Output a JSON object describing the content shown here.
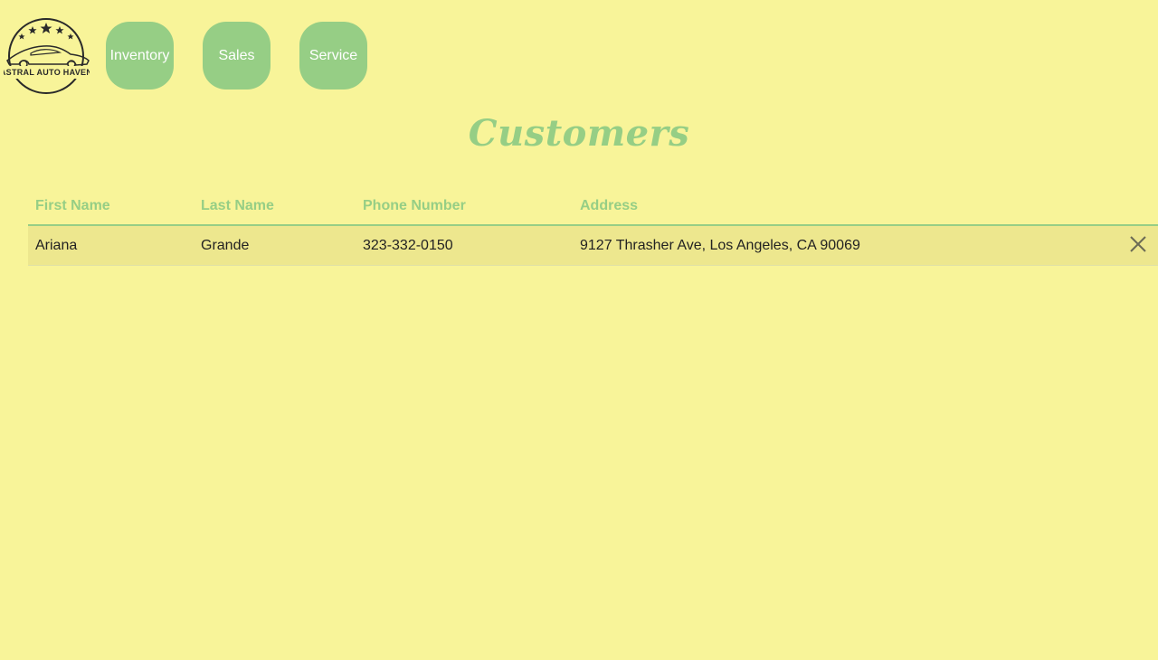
{
  "logo": {
    "text": "ASTRAL AUTO HAVEN",
    "icon": "car-logo-icon"
  },
  "nav": {
    "items": [
      {
        "label": "Inventory"
      },
      {
        "label": "Sales"
      },
      {
        "label": "Service"
      }
    ]
  },
  "colors": {
    "background": "#f8f499",
    "accent": "#96ce85",
    "row_background": "#ede78e"
  },
  "page": {
    "title": "Customers"
  },
  "table": {
    "headers": [
      "First Name",
      "Last Name",
      "Phone Number",
      "Address"
    ],
    "rows": [
      {
        "first_name": "Ariana",
        "last_name": "Grande",
        "phone": "323-332-0150",
        "address": "9127 Thrasher Ave, Los Angeles, CA 90069",
        "action_icon": "close-icon"
      }
    ]
  }
}
